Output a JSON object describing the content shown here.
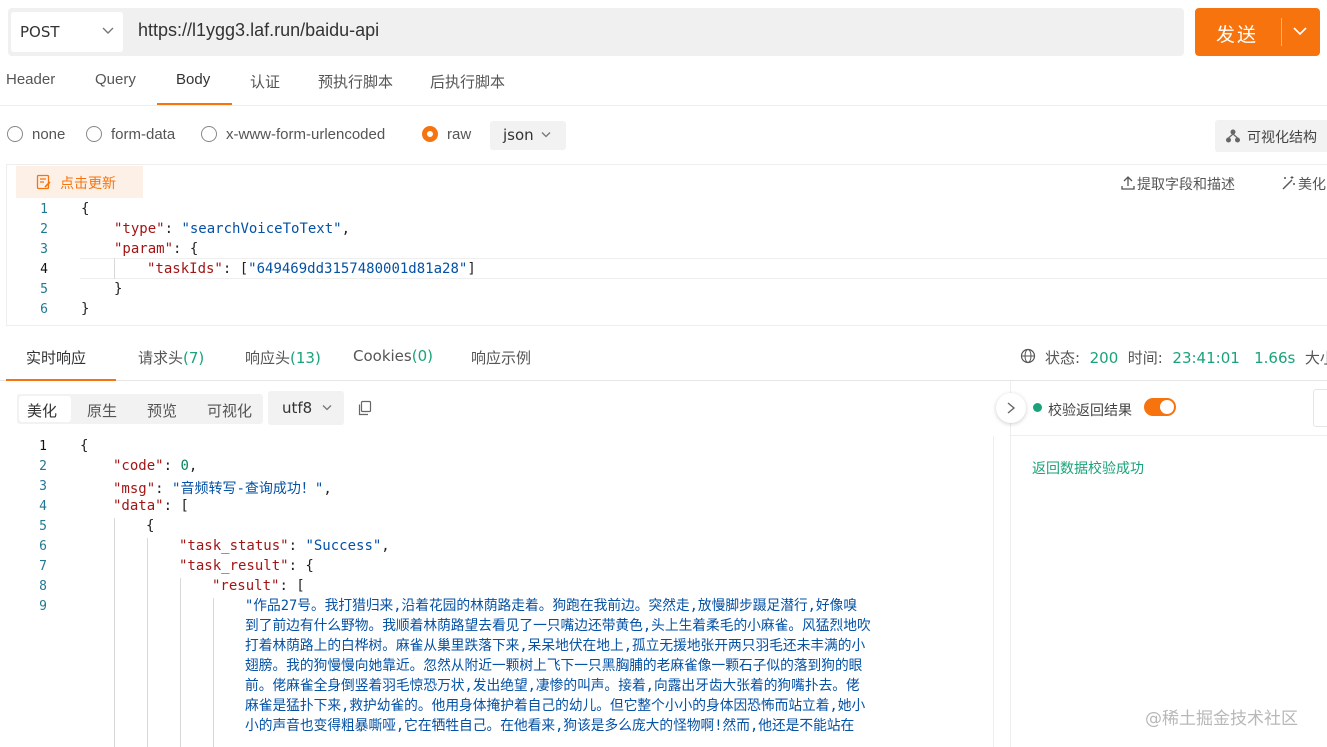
{
  "request": {
    "method": "POST",
    "url": "https://l1ygg3.laf.run/baidu-api",
    "send_label": "发送"
  },
  "tabs": [
    "Header",
    "Query",
    "Body",
    "认证",
    "预执行脚本",
    "后执行脚本"
  ],
  "active_tab": "Body",
  "body_types": [
    "none",
    "form-data",
    "x-www-form-urlencoded",
    "raw"
  ],
  "selected_body_type": "raw",
  "raw_format": "json",
  "visualize_structure_label": "可视化结构",
  "editor_toolbar": {
    "update_label": "点击更新",
    "extract_label": "提取字段和描述",
    "beautify_label": "美化"
  },
  "request_body": {
    "line_numbers": [
      "1",
      "2",
      "3",
      "4",
      "5",
      "6"
    ],
    "type_key": "\"type\"",
    "type_value": "\"searchVoiceToText\"",
    "param_key": "\"param\"",
    "taskids_key": "\"taskIds\"",
    "taskids_value": "\"649469dd3157480001d81a28\""
  },
  "response_tabs": [
    {
      "label": "实时响应",
      "count": ""
    },
    {
      "label": "请求头",
      "count": "(7)"
    },
    {
      "label": "响应头",
      "count": "(13)"
    },
    {
      "label": "Cookies",
      "count": "(0)"
    },
    {
      "label": "响应示例",
      "count": ""
    }
  ],
  "status": {
    "status_label": "状态:",
    "status_code": "200",
    "time_label": "时间:",
    "time_value": "23:41:01",
    "duration": "1.66s",
    "size_label": "大小"
  },
  "response_view": {
    "modes": [
      "美化",
      "原生",
      "预览",
      "可视化"
    ],
    "active_mode": "美化",
    "encoding": "utf8"
  },
  "validation": {
    "label": "校验返回结果",
    "enabled": true,
    "result": "返回数据校验成功"
  },
  "response_body": {
    "line_numbers": [
      "1",
      "2",
      "3",
      "4",
      "5",
      "6",
      "7",
      "8",
      "9"
    ],
    "code_key": "\"code\"",
    "code_value": "0",
    "msg_key": "\"msg\"",
    "msg_value": "\"音频转写-查询成功！\"",
    "data_key": "\"data\"",
    "task_status_key": "\"task_status\"",
    "task_status_value": "\"Success\"",
    "task_result_key": "\"task_result\"",
    "result_key": "\"result\"",
    "result_lines": [
      "\"作品27号。我打猎归来,沿着花园的林荫路走着。狗跑在我前边。突然走,放慢脚步蹑足潜行,好像嗅",
      "到了前边有什么野物。我顺着林荫路望去看见了一只嘴边还带黄色,头上生着柔毛的小麻雀。风猛烈地吹",
      "打着林荫路上的白桦树。麻雀从巢里跌落下来,呆呆地伏在地上,孤立无援地张开两只羽毛还未丰满的小",
      "翅膀。我的狗慢慢向她靠近。忽然从附近一颗树上飞下一只黑胸脯的老麻雀像一颗石子似的落到狗的眼",
      "前。佬麻雀全身倒竖着羽毛惊恐万状,发出绝望,凄惨的叫声。接着,向露出牙齿大张着的狗嘴扑去。佬",
      "麻雀是猛扑下来,救护幼雀的。他用身体掩护着自己的幼儿。但它整个小小的身体因恐怖而站立着,她小",
      "小的声音也变得粗暴嘶哑,它在牺牲自己。在他看来,狗该是多么庞大的怪物啊!然而,他还是不能站在"
    ]
  },
  "watermark": "@稀土掘金技术社区"
}
